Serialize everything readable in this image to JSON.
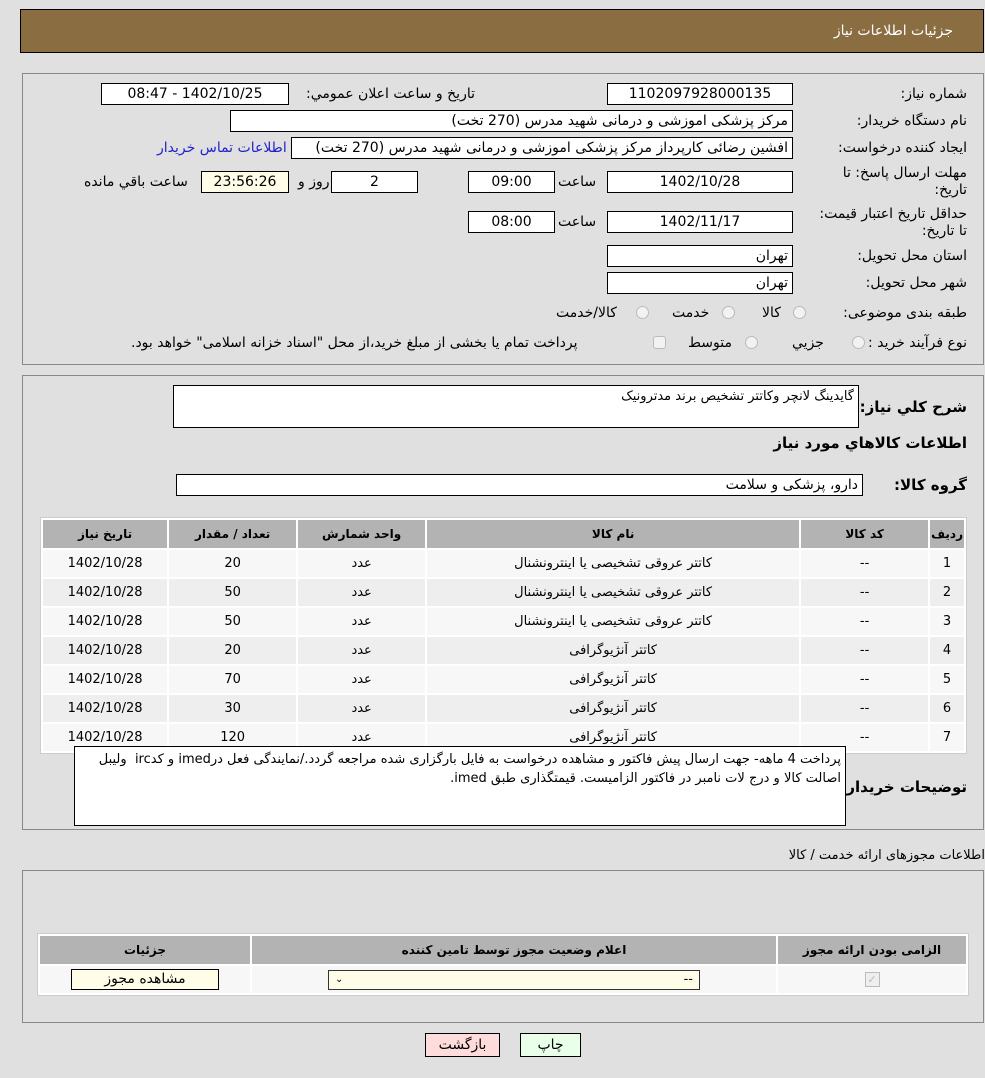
{
  "header": {
    "title": "جزئیات اطلاعات نیاز"
  },
  "details": {
    "need_number_label": "شماره نیاز:",
    "need_number": "1102097928000135",
    "announce_label": "تاریخ و ساعت اعلان عمومي:",
    "announce_value": "1402/10/25 - 08:47",
    "buyer_org_label": "نام دستگاه خریدار:",
    "buyer_org": "مرکز پزشکی  اموزشی و درمانی شهید مدرس (270 تخت)",
    "creator_label": "ایجاد کننده درخواست:",
    "creator": "افشین رضائی کارپرداز مرکز پزشکی  اموزشی و درمانی شهید مدرس (270 تخت)",
    "contact_link": "اطلاعات تماس خریدار",
    "reply_deadline_label": "مهلت ارسال پاسخ: تا تاریخ:",
    "reply_date": "1402/10/28",
    "time_label": "ساعت",
    "reply_time": "09:00",
    "days_remaining": "2",
    "days_label": "روز و",
    "time_remaining": "23:56:26",
    "remaining_label": "ساعت باقي مانده",
    "price_validity_label": "حداقل تاریخ اعتبار قیمت: تا تاریخ:",
    "price_validity_date": "1402/11/17",
    "price_validity_time": "08:00",
    "province_label": "استان محل تحویل:",
    "province": "تهران",
    "city_label": "شهر محل تحویل:",
    "city": "تهران",
    "category_label": "طبقه بندی موضوعی:",
    "category_options": [
      "کالا",
      "خدمت",
      "کالا/خدمت"
    ],
    "process_label": "نوع فرآیند خرید :",
    "process_options": [
      "جزيي",
      "متوسط"
    ],
    "treasury_note": "پرداخت تمام یا بخشی از مبلغ خرید،از محل \"اسناد خزانه اسلامی\" خواهد بود."
  },
  "description": {
    "label": "شرح كلي نياز:",
    "value": "گایدینگ لانچر وکاتتر تشخیص برند مدترونیک",
    "items_heading": "اطلاعات كالاهاي مورد نياز",
    "group_label": "گروه کالا:",
    "group_value": "دارو، پزشکی و سلامت"
  },
  "items_table": {
    "headers": [
      "ردیف",
      "کد کالا",
      "نام کالا",
      "واحد شمارش",
      "تعداد / مقدار",
      "تاریخ نیاز"
    ],
    "rows": [
      [
        "1",
        "--",
        "کاتتر عروقی تشخیصی یا اینترونشنال",
        "عدد",
        "20",
        "1402/10/28"
      ],
      [
        "2",
        "--",
        "کاتتر عروقی تشخیصی یا اینترونشنال",
        "عدد",
        "50",
        "1402/10/28"
      ],
      [
        "3",
        "--",
        "کاتتر عروقی تشخیصی یا اینترونشنال",
        "عدد",
        "50",
        "1402/10/28"
      ],
      [
        "4",
        "--",
        "کاتتر آنژیوگرافی",
        "عدد",
        "20",
        "1402/10/28"
      ],
      [
        "5",
        "--",
        "کاتتر آنژیوگرافی",
        "عدد",
        "70",
        "1402/10/28"
      ],
      [
        "6",
        "--",
        "کاتتر آنژیوگرافی",
        "عدد",
        "30",
        "1402/10/28"
      ],
      [
        "7",
        "--",
        "کاتتر آنژیوگرافی",
        "عدد",
        "120",
        "1402/10/28"
      ]
    ]
  },
  "buyer_notes": {
    "label": "توضیحات خریدار:",
    "value": "پرداخت 4 ماهه- جهت ارسال پیش فاکتور و مشاهده درخواست به فایل بارگزاری شده مراجعه گردد./نمایندگی فعل درimed و کدirc  ولیبل اصالت کالا و درج لات نامبر در فاکتور الزامیست. قیمتگذاری طبق imed."
  },
  "permits": {
    "section_title": "اطلاعات مجوزهای ارائه خدمت / کالا",
    "headers": [
      "الزامی بودن ارائه مجوز",
      "اعلام وضعیت مجوز توسط تامین کننده",
      "جزئیات"
    ],
    "select_value": "--",
    "view_button": "مشاهده مجوز"
  },
  "footer": {
    "print_button": "چاپ",
    "back_button": "بازگشت"
  },
  "colors": {
    "header_bg": "#8b6d42",
    "print_bg": "#eaffea",
    "back_bg": "#ffdcdc"
  }
}
